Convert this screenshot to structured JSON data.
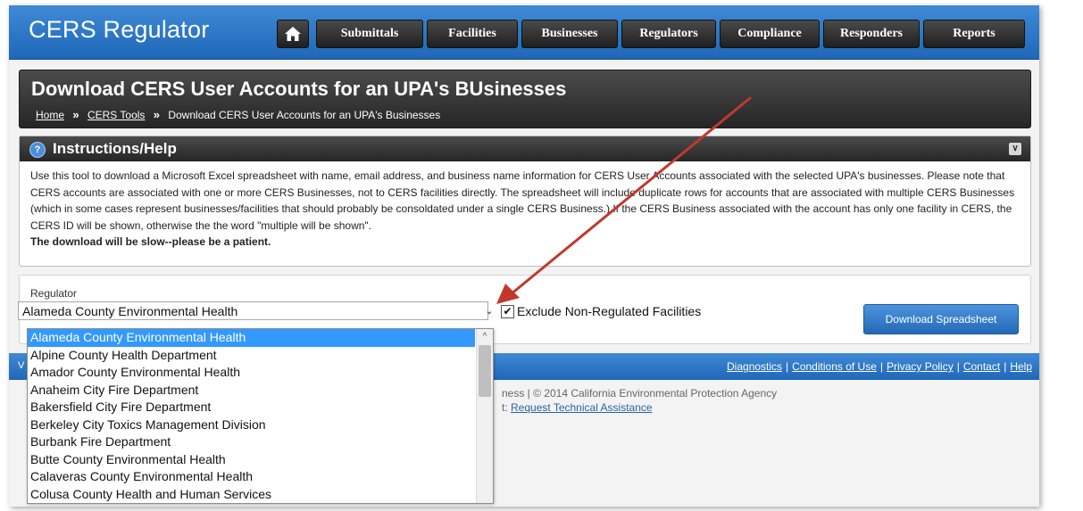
{
  "app": {
    "brand": "CERS Regulator"
  },
  "nav": {
    "home_icon": "home-icon",
    "items": [
      {
        "label": "Submittals"
      },
      {
        "label": "Facilities"
      },
      {
        "label": "Businesses"
      },
      {
        "label": "Regulators"
      },
      {
        "label": "Compliance"
      },
      {
        "label": "Responders"
      },
      {
        "label": "Reports"
      }
    ]
  },
  "page": {
    "title": "Download CERS User Accounts for an UPA's BUsinesses",
    "breadcrumb": {
      "home": "Home",
      "tools": "CERS Tools",
      "current": "Download CERS User Accounts for an UPA's Businesses",
      "separator": "»"
    }
  },
  "instructions": {
    "title": "Instructions/Help",
    "icon": "info-icon",
    "collapse_icon": "collapse-icon",
    "body": "Use this tool to download a Microsoft Excel spreadsheet with name, email address, and business name information for CERS User Accounts associated with the selected UPA's businesses. Please note that CERS accounts are associated with one or more CERS Businesses, not to CERS facilities directly. The spreadsheet will include duplicate rows for accounts that are associated with multiple CERS Businesses (which in some cases represent businesses/facilities that should probably be consoldated under a single CERS Business.) If the CERS Business associated with the account has only one facility in CERS, the CERS ID will be shown, otherwise the the word \"multiple will be shown\".",
    "note": "The download will be slow--please be a patient."
  },
  "form": {
    "regulator_label": "Regulator",
    "regulator_value": "Alameda County Environmental Health",
    "exclude_label": "Exclude Non-Regulated Facilities",
    "exclude_checked": "✔",
    "download_button": "Download Spreadsheet"
  },
  "dropdown": {
    "options": [
      "Alameda County Environmental Health",
      "Alpine County Health Department",
      "Amador County Environmental Health",
      "Anaheim City Fire Department",
      "Bakersfield City Fire Department",
      "Berkeley City Toxics Management Division",
      "Burbank Fire Department",
      "Butte County Environmental Health",
      "Calaveras County Environmental Health",
      "Colusa County Health and Human Services"
    ],
    "selected_index": 0
  },
  "footer": {
    "left": "V",
    "links": [
      "Diagnostics",
      "Conditions of Use",
      "Privacy Policy",
      "Contact",
      "Help"
    ],
    "copyright": "ness | © 2014 California Environmental Protection Agency",
    "support_prefix": "t:",
    "support_link": "Request Technical Assistance"
  },
  "colors": {
    "brand_blue": "#2a74c6",
    "dark_panel": "#333333",
    "selected_option": "#3399ff",
    "annotation_arrow": "#c0392b"
  }
}
